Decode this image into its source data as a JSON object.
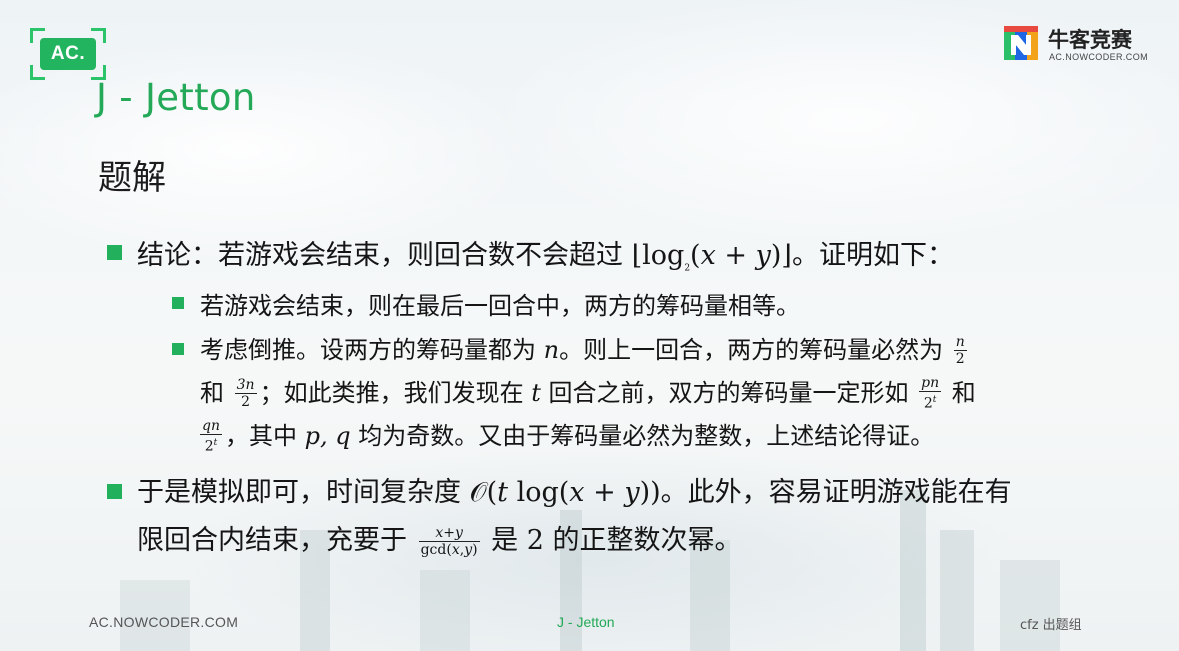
{
  "header": {
    "ac_logo_text": "AC.",
    "brand_name": "牛客竞赛",
    "brand_url": "AC.NOWCODER.COM"
  },
  "slide": {
    "title": "J - Jetton",
    "section": "题解"
  },
  "content": {
    "bullet1": {
      "before": "结论：若游戏会结束，则回合数不会超过 ",
      "after": "。证明如下："
    },
    "sub1": "若游戏会结束，则在最后一回合中，两方的筹码量相等。",
    "sub2": {
      "line1_a": "考虑倒推。设两方的筹码量都为 ",
      "var_n": "n",
      "line1_b": "。则上一回合，两方的筹码量必然为",
      "line2_a": "和 ",
      "line2_b": "；如此类推，我们发现在 ",
      "var_t": "t",
      "line2_c": " 回合之前，双方的筹码量一定形如",
      "line2_d": " 和",
      "line3_a": "，其中 ",
      "var_pq": "p, q",
      "line3_b": " 均为奇数。又由于筹码量必然为整数，上述结论得证。"
    },
    "bullet2": {
      "line1_a": "于是模拟即可，时间复杂度 ",
      "line1_b": "。此外，容易证明游戏能在有",
      "line2_a": "限回合内结束，充要于 ",
      "line2_b": " 是 ",
      "num_two": "2",
      "line2_c": " 的正整数次幂。"
    }
  },
  "footer": {
    "left": "AC.NOWCODER.COM",
    "center": "J - Jetton",
    "right": "cfz 出题组"
  },
  "colors": {
    "accent_green": "#23a957",
    "bullet_green": "#22b05c"
  }
}
